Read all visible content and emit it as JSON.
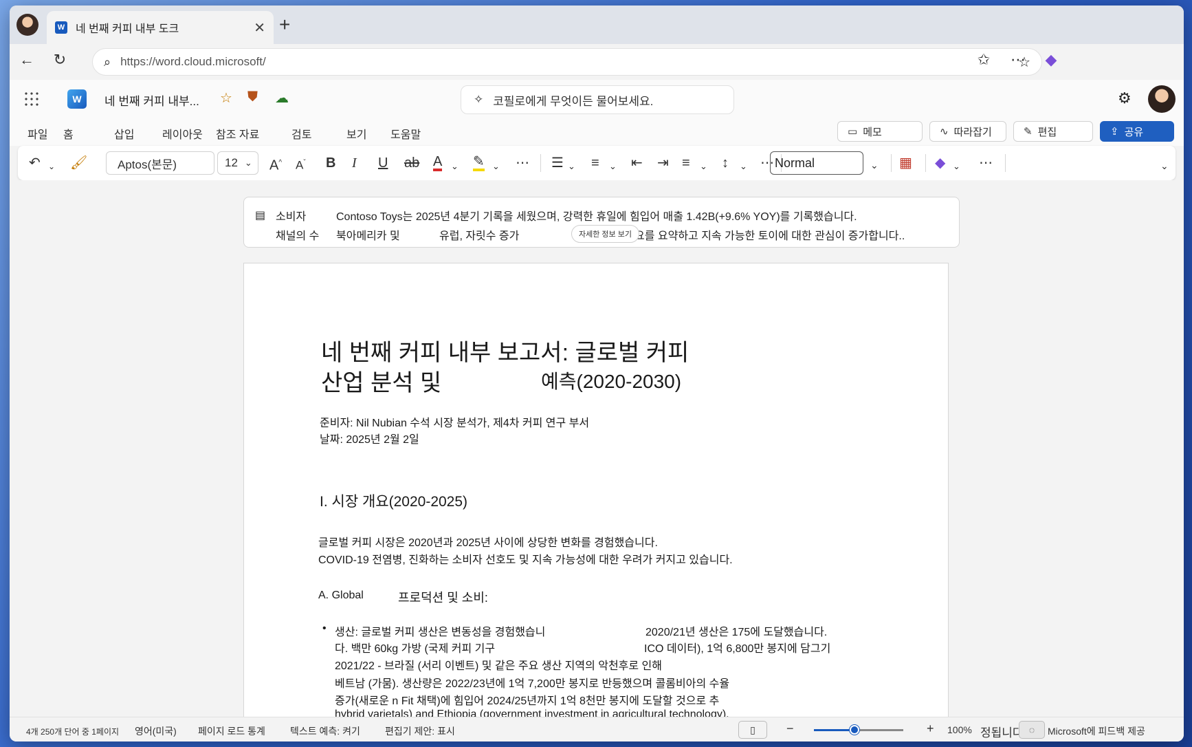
{
  "browser": {
    "tab_title": "네 번째 커피 내부 도크",
    "url": "https://word.cloud.microsoft/"
  },
  "app": {
    "doc_name": "네 번째 커피 내부...",
    "copilot_placeholder": "코필로에게 무엇이든 물어보세요."
  },
  "ribbon": {
    "tabs": [
      "파일",
      "홈",
      "삽입",
      "레이아웃",
      "참조 자료",
      "검토",
      "보기",
      "도움말"
    ],
    "comments_label": "메모",
    "catchup_label": "따라잡기",
    "edit_label": "편집",
    "share_label": "공유"
  },
  "toolbar": {
    "font_name": "Aptos(본문)",
    "font_size": "12",
    "style_name": "Normal"
  },
  "summary": {
    "label_line1": "소비자",
    "text_line1": "Contoso Toys는 2025년 4분기 기록을 세웠으며, 강력한 휴일에 힘입어 매출 1.42B(+9.6% YOY)를 기록했습니다.",
    "label_line2": "채널의 수",
    "text_line2_a": "북아메리카 및",
    "text_line2_b": "유럽, 자릿수 증가",
    "text_line2_c": "요를 요약하고 지속 가능한 토이에 대한 관심이 증가합니다..",
    "details_pill": "자세한 정보 보기"
  },
  "document": {
    "title_line1": "네 번째 커피 내부 보고서: 글로벌 커피",
    "title_line2a": "산업 분석 및",
    "title_line2b": "예측(2020-2030)",
    "prepared_by": "준비자: Nil Nubian 수석 시장 분석가, 제4차 커피 연구 부서",
    "date": "날짜: 2025년 2월 2일",
    "section1_heading": "I. 시장 개요(2020-2025)",
    "section1_p1": "글로벌 커피 시장은 2020년과 2025년 사이에 상당한 변화를 경험했습니다.",
    "section1_p2": "COVID-19 전염병, 진화하는 소비자 선호도 및 지속 가능성에 대한 우려가 커지고 있습니다.",
    "subsection_a_prefix": "A. Global",
    "subsection_a_rest": "프로덕션 및 소비:",
    "bullet": "•",
    "bullet_l1a": "생산: 글로벌 커피 생산은 변동성을 경험했습니",
    "bullet_l1b": "2020/21년 생산은 175에 도달했습니다.",
    "bullet_l2a": "다. 백만 60kg 가방 (국제 커피 기구",
    "bullet_l2b": "ICO 데이터), 1억 6,800만 봉지에 담그기",
    "bullet_l3": "2021/22 - 브라질 (서리 이벤트) 및 같은 주요 생산 지역의 악천후로 인해",
    "bullet_l4": "베트남 (가뭄). 생산량은 2022/23년에 1억 7,200만 봉지로 반등했으며 콜롬비아의 수율",
    "bullet_l5": "증가(새로운 n Fit 채택)에 힘입어 2024/25년까지 1억 8천만 봉지에 도달할 것으로 추",
    "bullet_l6": "hybrid varietals) and Ethiopia (government investment in agricultural technology)."
  },
  "status": {
    "word_count": "4개 250개 단어 중 1페이지",
    "language": "영어(미국)",
    "load_stats": "페이지 로드 통계",
    "text_prediction": "텍스트 예측: 켜기",
    "editor": "편집기 제안: 표시",
    "zoom": "100%",
    "zoom_fraction": 0.45,
    "fit_label": "정됩니다.",
    "feedback": "Microsoft에 피드백 제공"
  },
  "colors": {
    "accent": "#185abd",
    "share": "#1f5fc0"
  }
}
